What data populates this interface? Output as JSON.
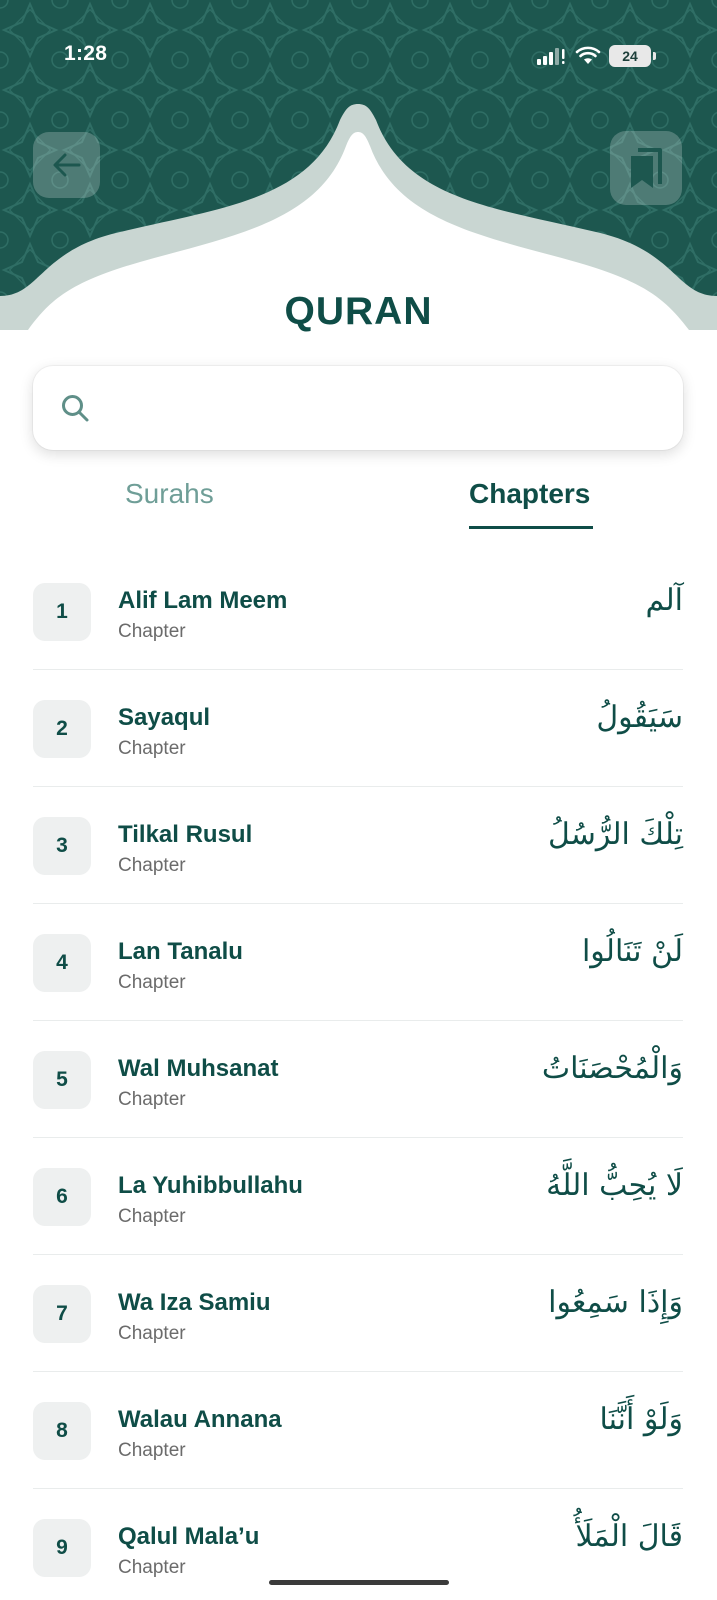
{
  "status_bar": {
    "time": "1:28",
    "battery": "24"
  },
  "header": {
    "title": "QURAN"
  },
  "search": {
    "placeholder": ""
  },
  "tabs": [
    {
      "label": "Surahs",
      "active": false
    },
    {
      "label": "Chapters",
      "active": true
    }
  ],
  "chapters": [
    {
      "number": "1",
      "name": "Alif Lam Meem",
      "subtitle": "Chapter",
      "arabic": "آلم"
    },
    {
      "number": "2",
      "name": "Sayaqul",
      "subtitle": "Chapter",
      "arabic": "سَيَقُولُ"
    },
    {
      "number": "3",
      "name": "Tilkal Rusul",
      "subtitle": "Chapter",
      "arabic": "تِلْكَ الرُّسُلُ"
    },
    {
      "number": "4",
      "name": "Lan Tanalu",
      "subtitle": "Chapter",
      "arabic": "لَنْ تَنَالُوا"
    },
    {
      "number": "5",
      "name": "Wal Muhsanat",
      "subtitle": "Chapter",
      "arabic": "وَالْمُحْصَنَاتُ"
    },
    {
      "number": "6",
      "name": "La Yuhibbullahu",
      "subtitle": "Chapter",
      "arabic": "لَا يُحِبُّ اللَّهُ"
    },
    {
      "number": "7",
      "name": "Wa Iza Samiu",
      "subtitle": "Chapter",
      "arabic": "وَإِذَا سَمِعُوا"
    },
    {
      "number": "8",
      "name": "Walau Annana",
      "subtitle": "Chapter",
      "arabic": "وَلَوْ أَنَّنَا"
    },
    {
      "number": "9",
      "name": "Qalul Mala’u",
      "subtitle": "Chapter",
      "arabic": "قَالَ الْمَلَأُ"
    }
  ],
  "colors": {
    "primary": "#0f4d47",
    "header_bg": "#1d574f",
    "muted_tab": "#6f9e97",
    "arch": "#c9d6d2"
  },
  "icons": {
    "back": "arrow-left-icon",
    "bookmark": "bookmark-icon",
    "search": "search-icon",
    "signal": "signal-icon",
    "wifi": "wifi-icon"
  }
}
